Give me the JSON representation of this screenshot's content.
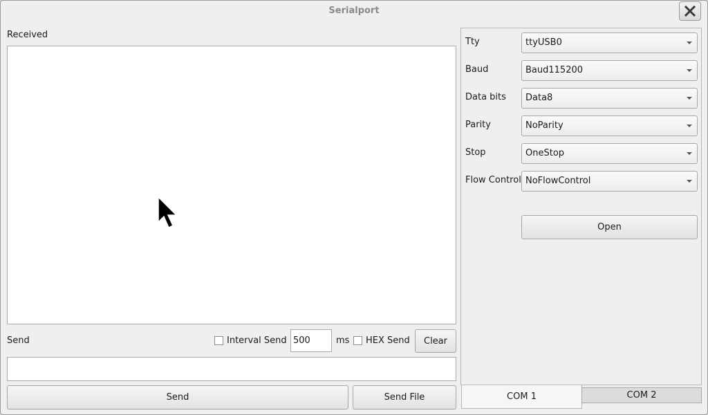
{
  "window": {
    "title": "Serialport",
    "close_icon": "close-x-icon"
  },
  "received": {
    "label": "Received",
    "content": ""
  },
  "send_row": {
    "label": "Send",
    "interval_send_label": "Interval Send",
    "interval_send_checked": false,
    "interval_value": "500",
    "interval_unit": "ms",
    "hex_send_label": "HEX Send",
    "hex_send_checked": false,
    "clear_label": "Clear"
  },
  "send_input": {
    "value": ""
  },
  "buttons": {
    "send_label": "Send",
    "send_file_label": "Send File",
    "open_label": "Open"
  },
  "settings": [
    {
      "label": "Tty",
      "value": "ttyUSB0"
    },
    {
      "label": "Baud",
      "value": "Baud115200"
    },
    {
      "label": "Data bits",
      "value": "Data8"
    },
    {
      "label": "Parity",
      "value": "NoParity"
    },
    {
      "label": "Stop",
      "value": "OneStop"
    },
    {
      "label": "Flow Control",
      "value": "NoFlowControl"
    }
  ],
  "tabs": [
    {
      "label": "COM 1",
      "active": true
    },
    {
      "label": "COM 2",
      "active": false
    }
  ]
}
